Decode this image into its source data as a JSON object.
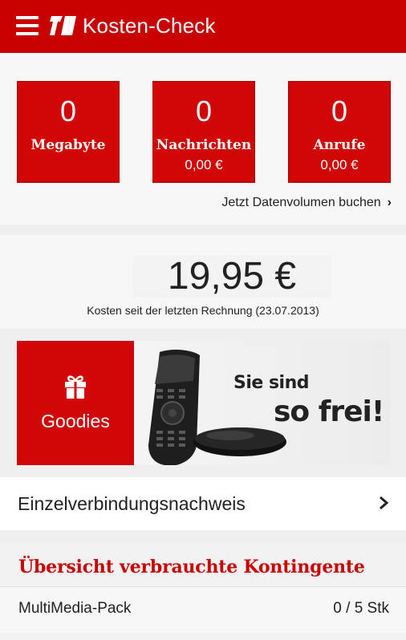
{
  "header": {
    "title": "Kosten-Check",
    "menu_icon": "hamburger-menu-icon",
    "logo_icon": "brand-logo-icon",
    "accent_color": "#c90000"
  },
  "usage_tiles": [
    {
      "value": "0",
      "label": "Megabyte",
      "cost": ""
    },
    {
      "value": "0",
      "label": "Nachrichten",
      "cost": "0,00 €"
    },
    {
      "value": "0",
      "label": "Anrufe",
      "cost": "0,00 €"
    }
  ],
  "data_link": {
    "label": "Jetzt Datenvolumen buchen",
    "icon": "chevron-right-icon"
  },
  "costs": {
    "amount": "19,95 €",
    "caption": "Kosten seit der letzten Rechnung (23.07.2013)"
  },
  "promo": {
    "goodies_label": "Goodies",
    "goodies_icon": "gift-icon",
    "banner_line1": "Sie sind",
    "banner_line2": "so frei!"
  },
  "itemized": {
    "label": "Einzelverbindungsnachweis",
    "icon": "chevron-right-icon"
  },
  "overview": {
    "title": "Übersicht verbrauchte Kontingente",
    "items": [
      {
        "name": "MultiMedia-Pack",
        "value": "0 / 5 Stk"
      }
    ]
  }
}
